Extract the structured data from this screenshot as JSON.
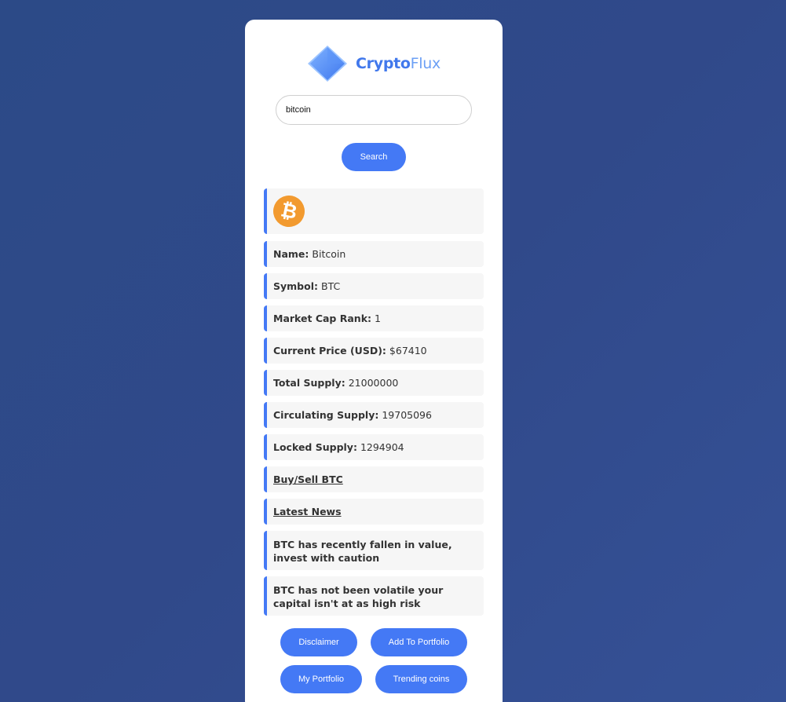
{
  "brand": {
    "name_bold": "Crypto",
    "name_light": "Flux",
    "logo_icon": "diamond-logo-icon"
  },
  "search": {
    "value": "bitcoin",
    "button_label": "Search"
  },
  "coin": {
    "icon": "bitcoin-icon",
    "icon_glyph": "₿",
    "icon_color": "#f29a2f",
    "details": [
      {
        "label": "Name:",
        "value": "Bitcoin"
      },
      {
        "label": "Symbol:",
        "value": "BTC"
      },
      {
        "label": "Market Cap Rank:",
        "value": "1"
      },
      {
        "label": "Current Price (USD):",
        "value": "$67410"
      },
      {
        "label": "Total Supply:",
        "value": "21000000"
      },
      {
        "label": "Circulating Supply:",
        "value": "19705096"
      },
      {
        "label": "Locked Supply:",
        "value": "1294904"
      }
    ],
    "links": {
      "buy_sell": "Buy/Sell BTC",
      "news": "Latest News"
    },
    "insights": [
      "BTC has recently fallen in value, invest with caution",
      "BTC has not been volatile your capital isn't at as high risk"
    ]
  },
  "actions": {
    "disclaimer": "Disclaimer",
    "add_to_portfolio": "Add To Portfolio",
    "my_portfolio": "My Portfolio",
    "trending": "Trending coins"
  },
  "colors": {
    "accent": "#4479f5",
    "background": "#30498a",
    "row_background": "#f6f6f6"
  }
}
